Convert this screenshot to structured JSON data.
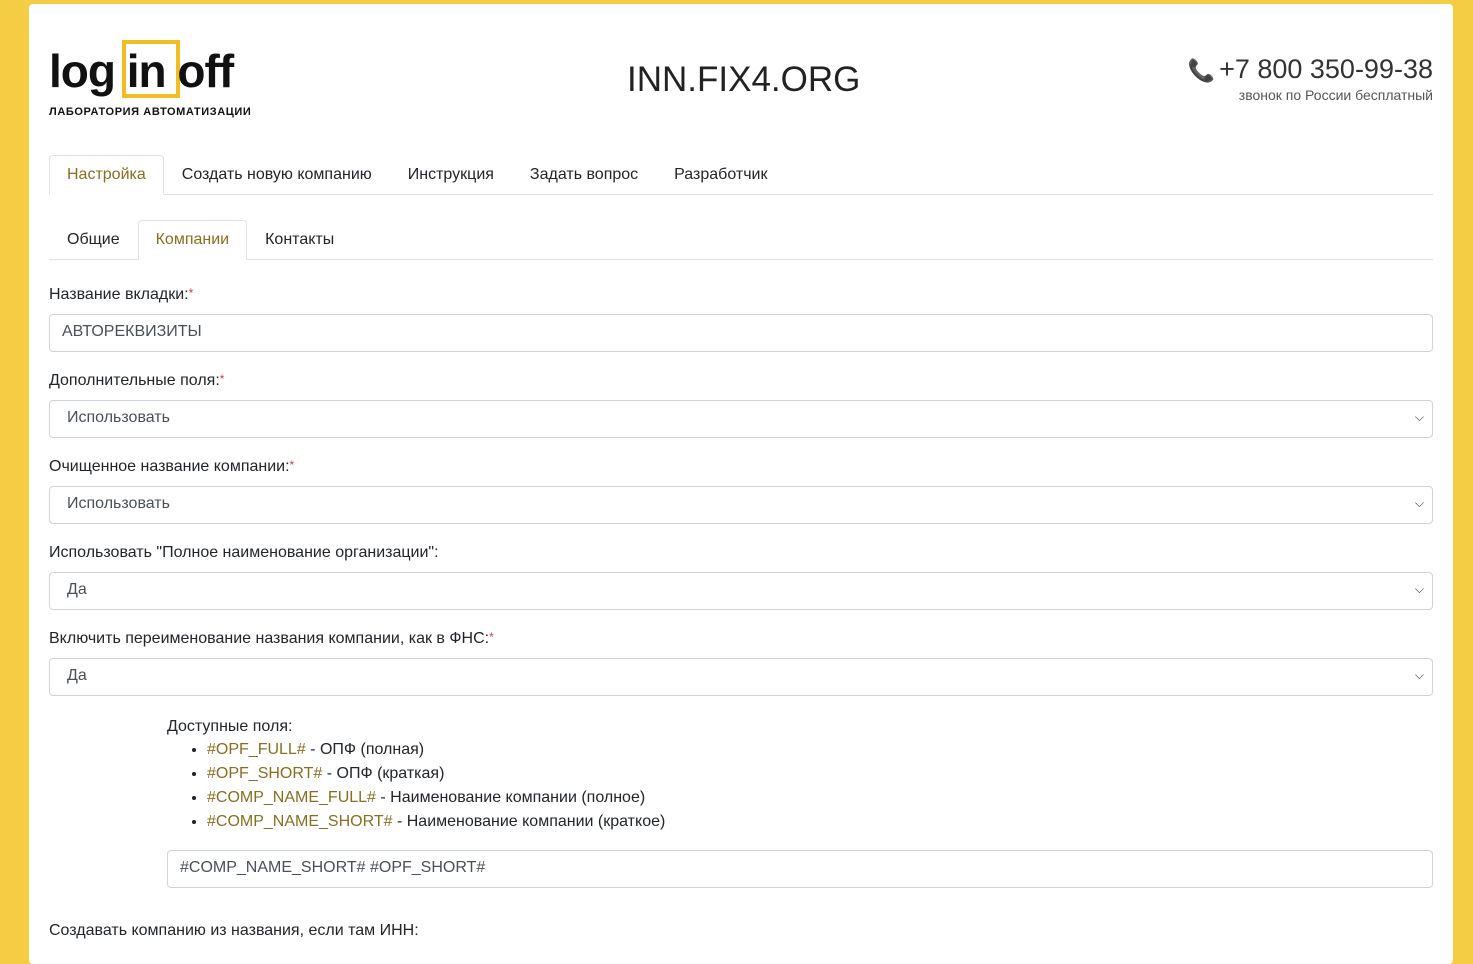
{
  "header": {
    "logo_text": "log in off",
    "logo_sub": "ЛАБОРАТОРИЯ АВТОМАТИЗАЦИИ",
    "site": "INN.FIX4.ORG",
    "phone": "+7 800 350-99-38",
    "phone_note": "звонок по России бесплатный",
    "phone_icon": "phone-icon"
  },
  "main_tabs": [
    {
      "label": "Настройка"
    },
    {
      "label": "Создать новую компанию"
    },
    {
      "label": "Инструкция"
    },
    {
      "label": "Задать вопрос"
    },
    {
      "label": "Разработчик"
    }
  ],
  "sub_tabs": [
    {
      "label": "Общие"
    },
    {
      "label": "Компании"
    },
    {
      "label": "Контакты"
    }
  ],
  "fields": [
    {
      "label": "Название вкладки:",
      "value": "АВТОРЕКВИЗИТЫ"
    },
    {
      "label": "Дополнительные поля:",
      "value": "Использовать"
    },
    {
      "label": "Очищенное название компании:",
      "value": "Использовать"
    },
    {
      "label": "Использовать \"Полное наименование организации\":",
      "value": "Да"
    },
    {
      "label": "Включить переименование названия компании, как в ФНС:",
      "value": "Да"
    }
  ],
  "available": {
    "title": "Доступные поля:",
    "items": [
      {
        "code": "#OPF_FULL#",
        "desc": " - ОПФ (полная)"
      },
      {
        "code": "#OPF_SHORT#",
        "desc": " - ОПФ (краткая)"
      },
      {
        "code": "#COMP_NAME_FULL#",
        "desc": " - Наименование компании (полное)"
      },
      {
        "code": "#COMP_NAME_SHORT#",
        "desc": " - Наименование компании (краткое)"
      }
    ],
    "template_value": "#COMP_NAME_SHORT# #OPF_SHORT#"
  },
  "last_label": "Создавать компанию из названия, если там ИНН:",
  "required_mark": "*"
}
